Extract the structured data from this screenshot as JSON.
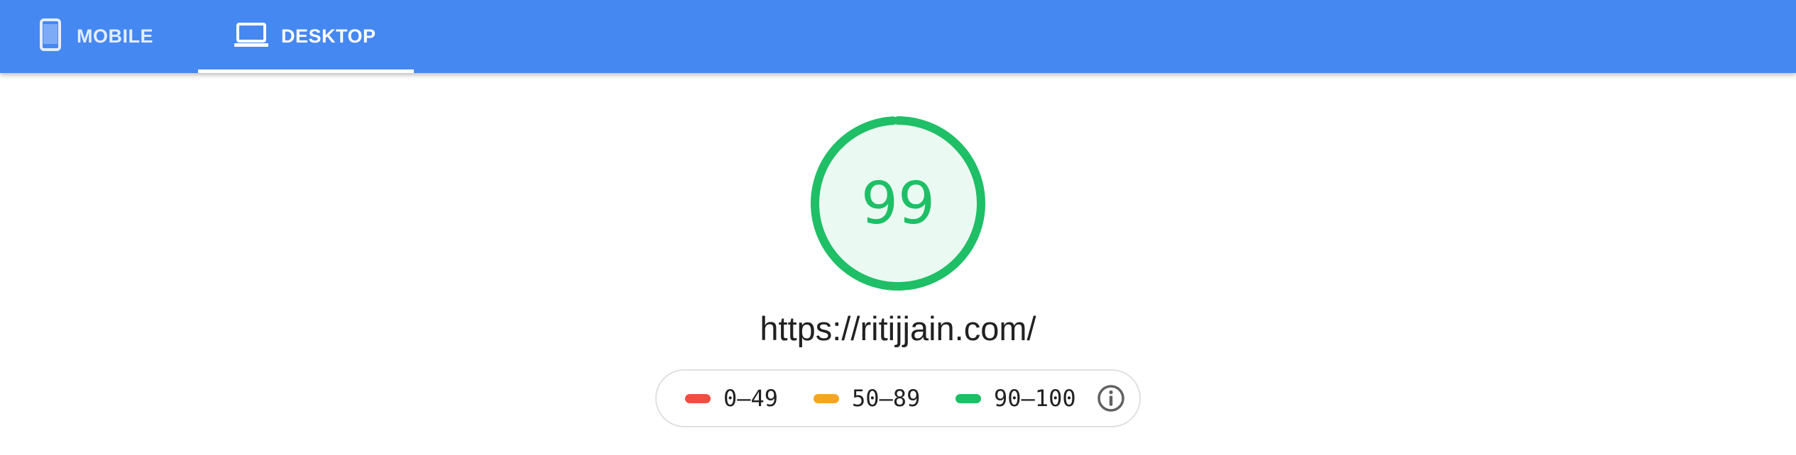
{
  "tabs": [
    {
      "label": "MOBILE",
      "icon": "mobile-phone-icon",
      "selected": false
    },
    {
      "label": "DESKTOP",
      "icon": "laptop-icon",
      "selected": true
    }
  ],
  "score": {
    "value": "99",
    "fraction": 0.99,
    "color": "#1EBF66",
    "fill_color": "#EAF9F1"
  },
  "url": "https://ritijjain.com/",
  "legend": {
    "items": [
      {
        "range": "0–49",
        "color": "#F04E41"
      },
      {
        "range": "50–89",
        "color": "#F6A522"
      },
      {
        "range": "90–100",
        "color": "#1EBF66"
      }
    ],
    "info_icon": "info-icon"
  },
  "colors": {
    "header": "#4688F1"
  }
}
